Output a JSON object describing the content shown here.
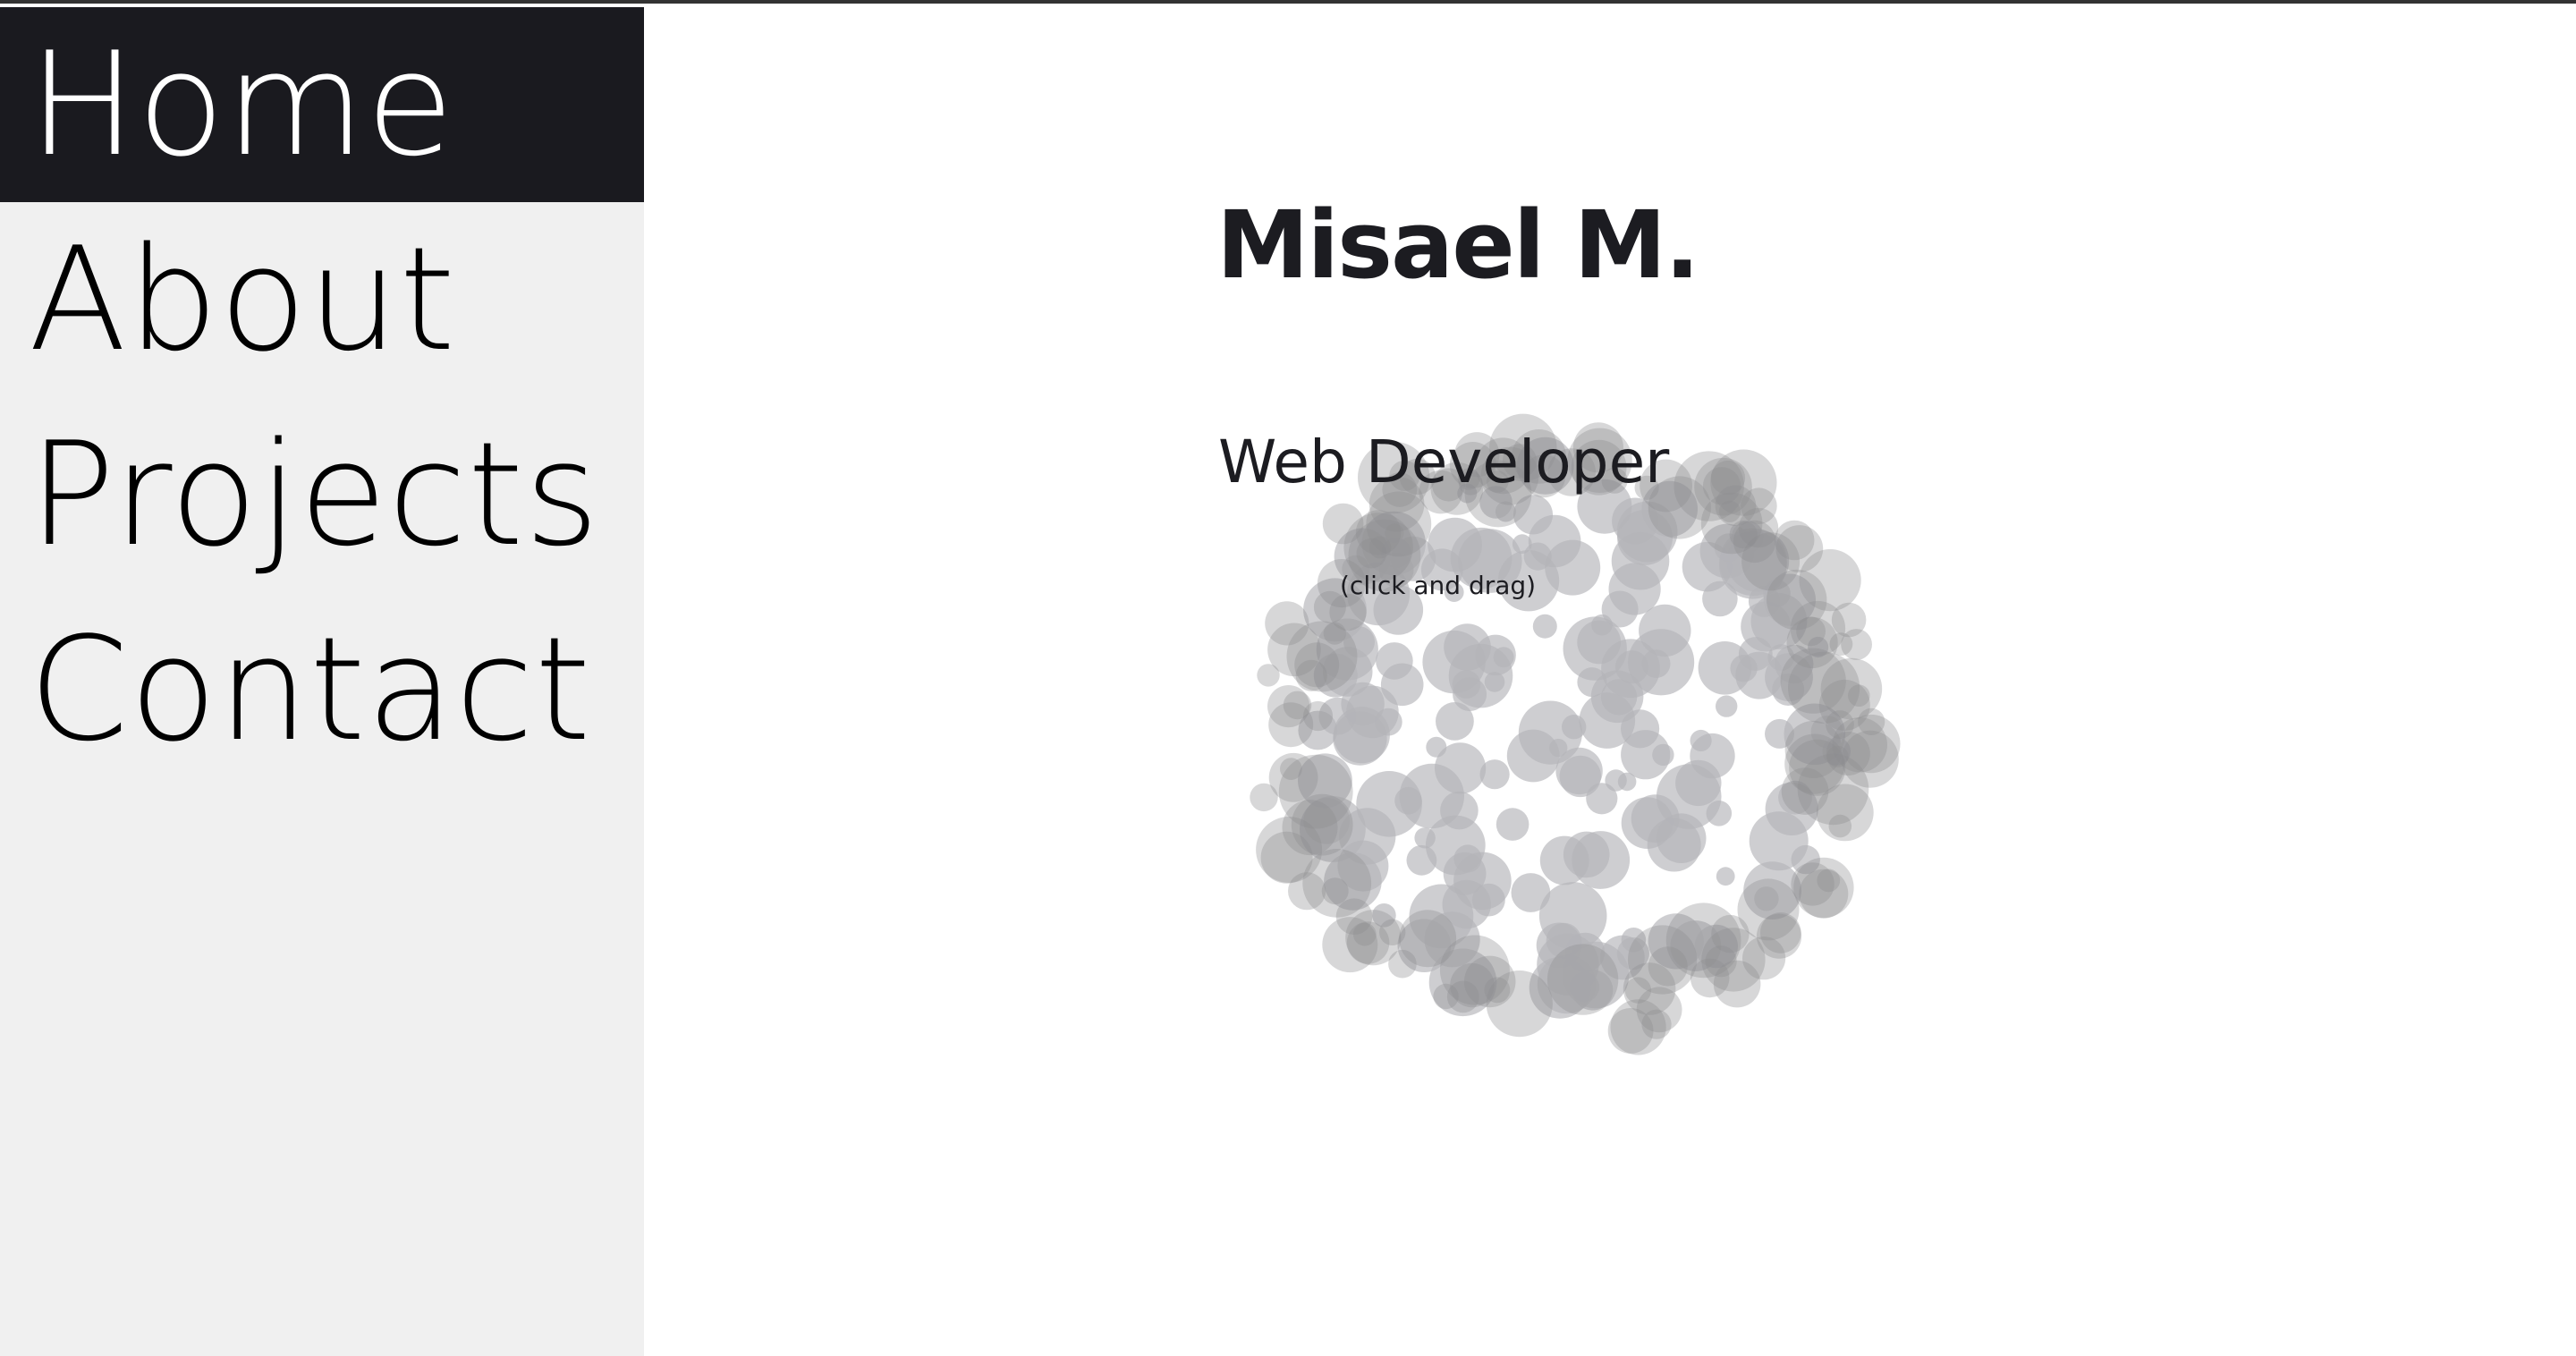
{
  "nav": {
    "items": [
      {
        "label": "Home",
        "active": true
      },
      {
        "label": "About",
        "active": false
      },
      {
        "label": "Projects",
        "active": false
      },
      {
        "label": "Contact",
        "active": false
      }
    ]
  },
  "hero": {
    "name": "Misael M.",
    "role": "Web Developer",
    "hint": "(click and drag)"
  },
  "colors": {
    "sidebar_bg": "#f0f0f0",
    "active_bg": "#1a1a1f",
    "text": "#1c1c21",
    "bubble": "#b4b4b8"
  }
}
